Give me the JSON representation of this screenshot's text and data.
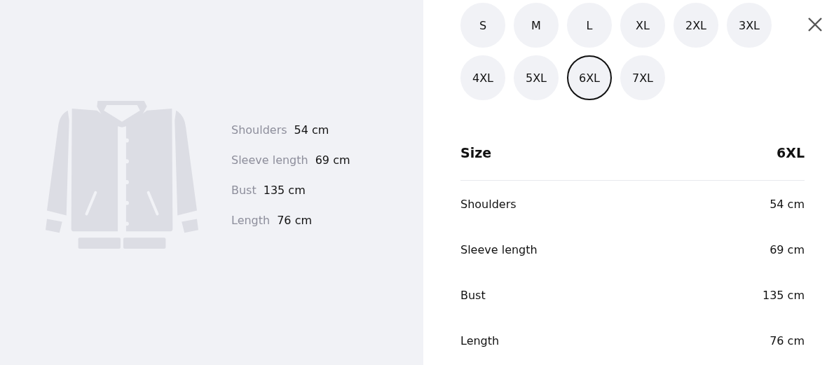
{
  "preview": {
    "measurements": [
      {
        "label": "Shoulders",
        "value": "54 cm"
      },
      {
        "label": "Sleeve length",
        "value": "69 cm"
      },
      {
        "label": "Bust",
        "value": "135 cm"
      },
      {
        "label": "Length",
        "value": "76 cm"
      }
    ]
  },
  "sizes": [
    {
      "label": "S",
      "selected": false
    },
    {
      "label": "M",
      "selected": false
    },
    {
      "label": "L",
      "selected": false
    },
    {
      "label": "XL",
      "selected": false
    },
    {
      "label": "2XL",
      "selected": false
    },
    {
      "label": "3XL",
      "selected": false
    },
    {
      "label": "4XL",
      "selected": false
    },
    {
      "label": "5XL",
      "selected": false
    },
    {
      "label": "6XL",
      "selected": true
    },
    {
      "label": "7XL",
      "selected": false
    }
  ],
  "table": {
    "header": {
      "label": "Size",
      "value": "6XL"
    },
    "rows": [
      {
        "label": "Shoulders",
        "value": "54 cm"
      },
      {
        "label": "Sleeve length",
        "value": "69 cm"
      },
      {
        "label": "Bust",
        "value": "135 cm"
      },
      {
        "label": "Length",
        "value": "76 cm"
      }
    ]
  }
}
